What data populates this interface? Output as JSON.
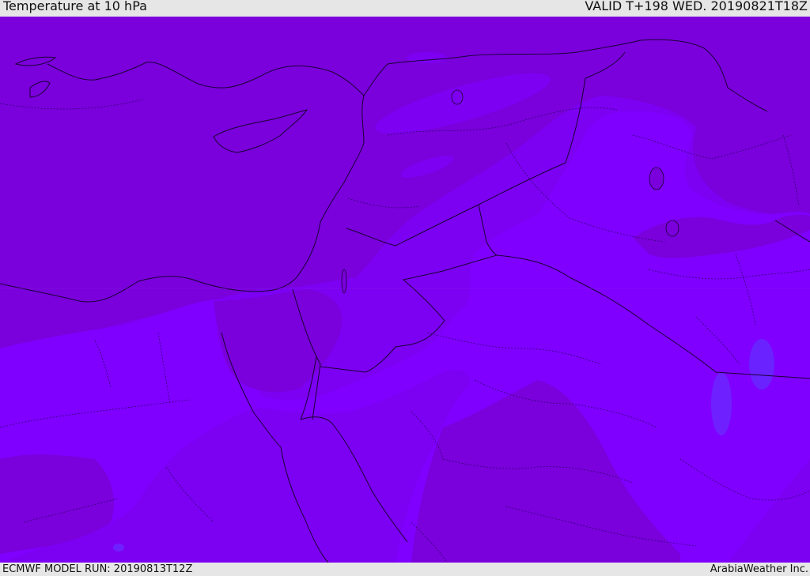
{
  "header": {
    "title": "Temperature at 10 hPa",
    "valid": "VALID T+198 WED. 20190821T18Z"
  },
  "footer": {
    "model_run": "ECMWF MODEL RUN: 20190813T12Z",
    "credit": "ArabiaWeather Inc."
  },
  "palette": {
    "dark_band": "#7a00dc",
    "mid_band": "#7d00f5",
    "light_band": "#7f00ff",
    "cold_spot": "#6a22ff",
    "borders": "#1a0033"
  }
}
